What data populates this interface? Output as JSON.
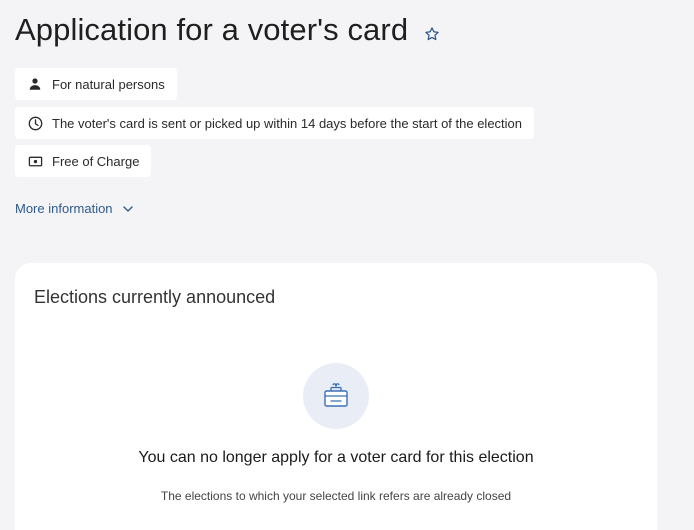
{
  "header": {
    "title": "Application for a voter's card",
    "favorite_icon": "star-outline-icon"
  },
  "info_chips": [
    {
      "icon": "person-icon",
      "text": "For natural persons"
    },
    {
      "icon": "clock-icon",
      "text": "The voter's card is sent or picked up within 14 days before the start of the election"
    },
    {
      "icon": "money-icon",
      "text": "Free of Charge"
    }
  ],
  "more_info": {
    "label": "More information",
    "icon": "chevron-down-icon"
  },
  "elections_card": {
    "title": "Elections currently announced",
    "empty_state": {
      "icon": "ballot-box-icon",
      "title": "You can no longer apply for a voter card for this election",
      "subtitle": "The elections to which your selected link refers are already closed"
    }
  },
  "colors": {
    "background": "#f4f4f6",
    "card": "#ffffff",
    "link": "#2f5a8a",
    "icon_accent": "#3b6fb5"
  }
}
